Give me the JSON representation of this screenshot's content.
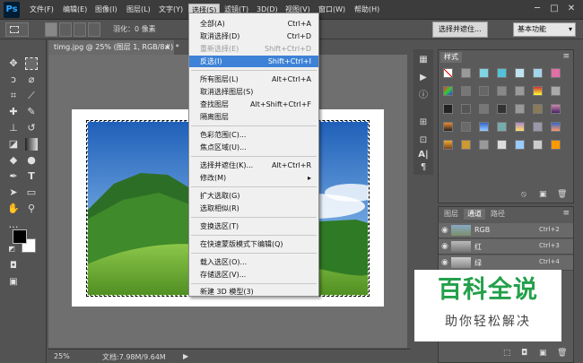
{
  "app": {
    "logo": "Ps"
  },
  "menubar": {
    "items": [
      "文件(F)",
      "编辑(E)",
      "图像(I)",
      "图层(L)",
      "文字(Y)",
      "选择(S)",
      "滤镜(T)",
      "3D(D)",
      "视图(V)",
      "窗口(W)",
      "帮助(H)"
    ],
    "active_index": 5
  },
  "window_controls": {
    "minimize": "─",
    "maximize": "□",
    "close": "✕"
  },
  "options_bar": {
    "feather_label": "羽化：0 像素",
    "select_and_mask": "选择并遮住...",
    "workspace": "基本功能",
    "workspace_arrow": "▾"
  },
  "document": {
    "tab_title": "timg.jpg @ 25% (图层 1, RGB/8#) *",
    "tab_close": "×"
  },
  "status": {
    "zoom": "25%",
    "doc_size": "文档:7.98M/9.64M",
    "arrow": "▶"
  },
  "select_menu": {
    "items": [
      {
        "label": "全部(A)",
        "shortcut": "Ctrl+A",
        "disabled": false
      },
      {
        "label": "取消选择(D)",
        "shortcut": "Ctrl+D",
        "disabled": false
      },
      {
        "label": "重新选择(E)",
        "shortcut": "Shift+Ctrl+D",
        "disabled": true
      },
      {
        "label": "反选(I)",
        "shortcut": "Shift+Ctrl+I",
        "disabled": false,
        "highlighted": true
      },
      {
        "label": "所有图层(L)",
        "shortcut": "Alt+Ctrl+A",
        "disabled": false
      },
      {
        "label": "取消选择图层(S)",
        "shortcut": "",
        "disabled": false
      },
      {
        "label": "查找图层",
        "shortcut": "Alt+Shift+Ctrl+F",
        "disabled": false
      },
      {
        "label": "隔离图层",
        "shortcut": "",
        "disabled": false
      },
      {
        "label": "色彩范围(C)...",
        "shortcut": "",
        "disabled": false
      },
      {
        "label": "焦点区域(U)...",
        "shortcut": "",
        "disabled": false
      },
      {
        "label": "选择并遮住(K)...",
        "shortcut": "Alt+Ctrl+R",
        "disabled": false
      },
      {
        "label": "修改(M)",
        "shortcut": "▸",
        "disabled": false
      },
      {
        "label": "扩大选取(G)",
        "shortcut": "",
        "disabled": false
      },
      {
        "label": "选取相似(R)",
        "shortcut": "",
        "disabled": false
      },
      {
        "label": "变换选区(T)",
        "shortcut": "",
        "disabled": false
      },
      {
        "label": "在快速蒙版模式下编辑(Q)",
        "shortcut": "",
        "disabled": false
      },
      {
        "label": "载入选区(O)...",
        "shortcut": "",
        "disabled": false
      },
      {
        "label": "存储选区(V)...",
        "shortcut": "",
        "disabled": false
      },
      {
        "label": "新建 3D 模型(3)",
        "shortcut": "",
        "disabled": false
      }
    ]
  },
  "styles_panel": {
    "title": "样式",
    "menu_icon": "≡",
    "footer_icons": [
      "⦸",
      "▣",
      "🗑"
    ]
  },
  "channels_panel": {
    "tabs": [
      "图层",
      "通道",
      "路径"
    ],
    "active_tab": 1,
    "menu_icon": "≡",
    "channels": [
      {
        "name": "RGB",
        "shortcut": "Ctrl+2"
      },
      {
        "name": "红",
        "shortcut": "Ctrl+3"
      },
      {
        "name": "绿",
        "shortcut": "Ctrl+4"
      }
    ],
    "footer_icons": [
      "⬚",
      "◘",
      "▣",
      "🗑"
    ]
  },
  "watermark": {
    "title": "百科全说",
    "subtitle": "助你轻松解决",
    "title_color": "#23a04b"
  },
  "colors": {
    "foreground": "#000000",
    "background": "#ffffff",
    "menu_highlight": "#3d82d6",
    "ui_dark": "#535353"
  },
  "tool_icons": [
    "move-tool",
    "marquee-tool",
    "lasso-tool",
    "quick-select-tool",
    "crop-tool",
    "eyedropper-tool",
    "healing-tool",
    "brush-tool",
    "stamp-tool",
    "history-brush-tool",
    "eraser-tool",
    "gradient-tool",
    "blur-tool",
    "dodge-tool",
    "pen-tool",
    "type-tool",
    "path-select-tool",
    "shape-tool",
    "hand-tool",
    "zoom-tool",
    "more-tools",
    "swap-colors",
    "quick-mask",
    "screen-mode"
  ]
}
